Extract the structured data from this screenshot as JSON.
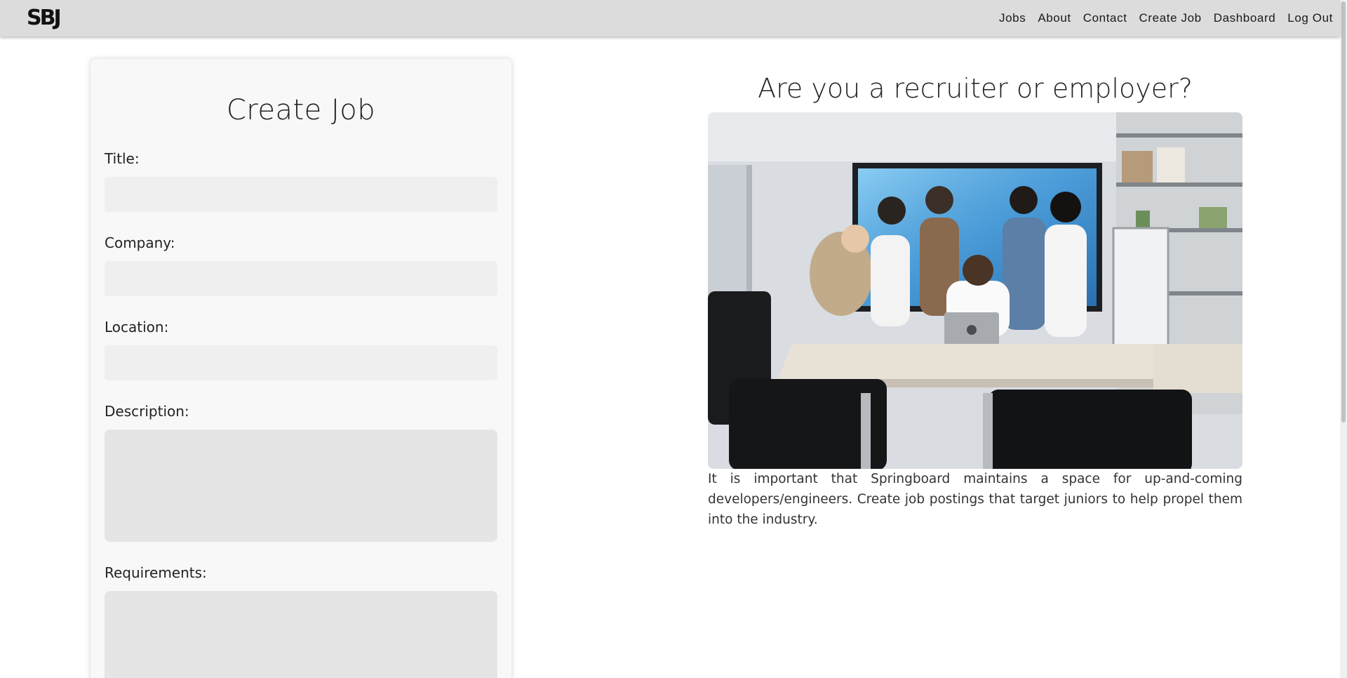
{
  "nav": {
    "logo": "SBJ",
    "links": [
      "Jobs",
      "About",
      "Contact",
      "Create Job",
      "Dashboard",
      "Log Out"
    ]
  },
  "form": {
    "title": "Create Job",
    "fields": {
      "title": {
        "label": "Title:",
        "value": ""
      },
      "company": {
        "label": "Company:",
        "value": ""
      },
      "location": {
        "label": "Location:",
        "value": ""
      },
      "description": {
        "label": "Description:",
        "value": ""
      },
      "requirements": {
        "label": "Requirements:",
        "value": ""
      }
    }
  },
  "promo": {
    "heading": "Are you a recruiter or employer?",
    "image_icon": "team-meeting-photo",
    "text": "It is important that Springboard maintains a space for up-and-coming developers/engineers. Create job postings that target juniors to help propel them into the industry."
  },
  "colors": {
    "navbar": "#dcdcdc",
    "card": "#f8f8f8",
    "input": "#efefef",
    "textarea": "#e5e5e5"
  }
}
